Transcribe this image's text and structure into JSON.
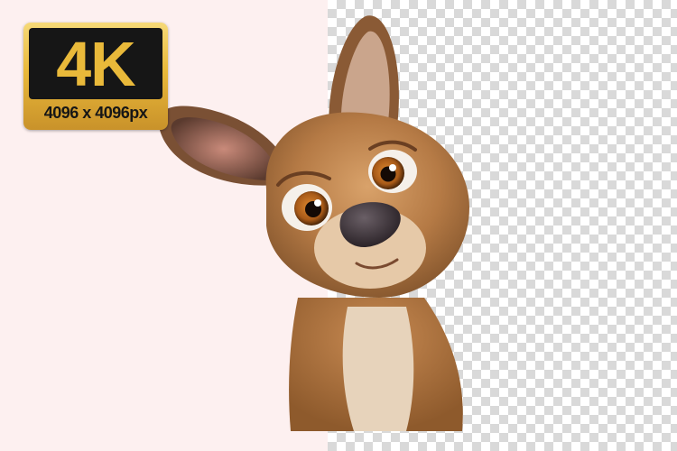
{
  "badge": {
    "title": "4K",
    "subtitle": "4096 x 4096px"
  },
  "colors": {
    "left_background": "#fdf0f0",
    "checker_light": "#ffffff",
    "checker_dark": "#d9d9d9",
    "gold": "#e9b93a",
    "gold_light": "#f6d978",
    "badge_inner": "#161616",
    "fur": "#b57a45",
    "fur_light": "#e9d5bd",
    "nose": "#3b3439",
    "eye_iris": "#a85a18"
  },
  "subject": {
    "icon": "cartoon-kangaroo-icon"
  }
}
